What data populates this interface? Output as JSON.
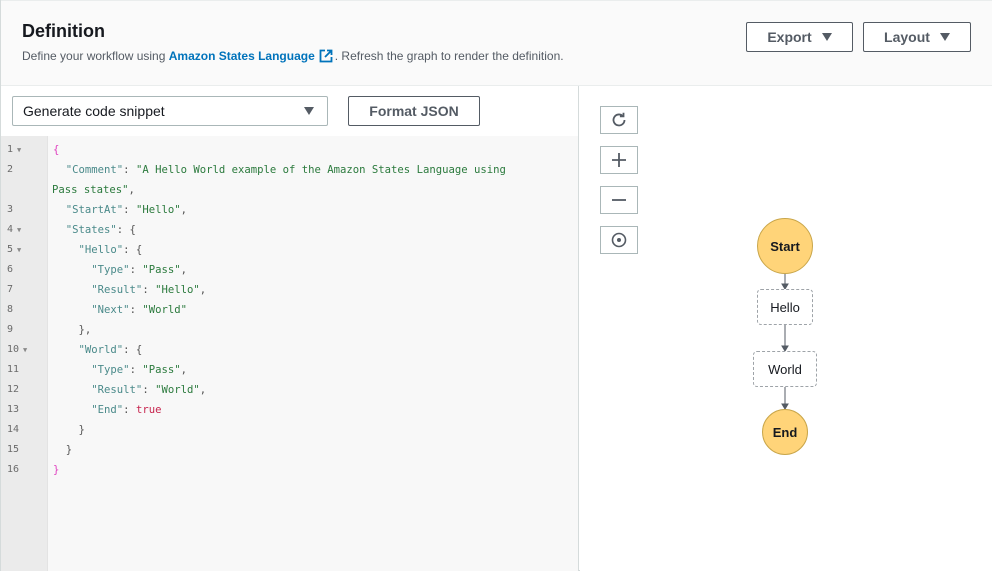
{
  "header": {
    "title": "Definition",
    "desc_prefix": "Define your workflow using ",
    "desc_link": "Amazon States Language",
    "desc_suffix": ". Refresh the graph to render the definition.",
    "export_label": "Export",
    "layout_label": "Layout"
  },
  "editor": {
    "snippet_select": "Generate code snippet",
    "format_label": "Format JSON",
    "line_numbers": [
      "1",
      "2",
      "3",
      "4",
      "5",
      "6",
      "7",
      "8",
      "9",
      "10",
      "11",
      "12",
      "13",
      "14",
      "15",
      "16"
    ],
    "lines": {
      "l1": "{",
      "l2_key": "\"Comment\"",
      "l2_val_a": "\"A Hello World example of the Amazon States Language using",
      "l2_val_b": "Pass states\"",
      "l3_key": "\"StartAt\"",
      "l3_val": "\"Hello\"",
      "l4_key": "\"States\"",
      "l5_key": "\"Hello\"",
      "l6_key": "\"Type\"",
      "l6_val": "\"Pass\"",
      "l7_key": "\"Result\"",
      "l7_val": "\"Hello\"",
      "l8_key": "\"Next\"",
      "l8_val": "\"World\"",
      "l9": "},",
      "l10_key": "\"World\"",
      "l11_key": "\"Type\"",
      "l11_val": "\"Pass\"",
      "l12_key": "\"Result\"",
      "l12_val": "\"World\"",
      "l13_key": "\"End\"",
      "l13_val": "true",
      "l14": "}",
      "l15": "}",
      "l16": "}"
    }
  },
  "graph": {
    "tools": [
      "refresh-icon",
      "zoom-in-icon",
      "zoom-out-icon",
      "center-icon"
    ],
    "nodes": {
      "start": "Start",
      "hello": "Hello",
      "world": "World",
      "end": "End"
    },
    "colors": {
      "terminal_fill": "#ffd479",
      "link": "#0073bb"
    }
  }
}
